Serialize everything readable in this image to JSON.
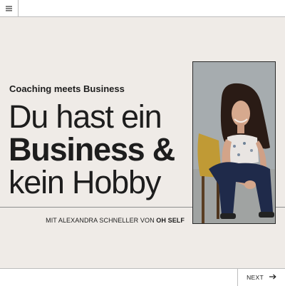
{
  "topbar": {
    "menu_icon": "hamburger-menu-icon"
  },
  "hero": {
    "subtitle": "Coaching meets Business",
    "headline": {
      "line1": "Du hast ein",
      "line2": "Business &",
      "line3": "kein Hobby"
    },
    "credit_prefix": "MIT ALEXANDRA SCHNELLER VON ",
    "credit_brand": "OH SELF"
  },
  "photo": {
    "icon": "portrait-photo"
  },
  "footer": {
    "next_label": "NEXT",
    "next_icon": "arrow-right-icon"
  },
  "colors": {
    "background": "#efebe7",
    "text": "#1d1d1d",
    "bar": "#ffffff",
    "divider": "#bdbdbd"
  }
}
